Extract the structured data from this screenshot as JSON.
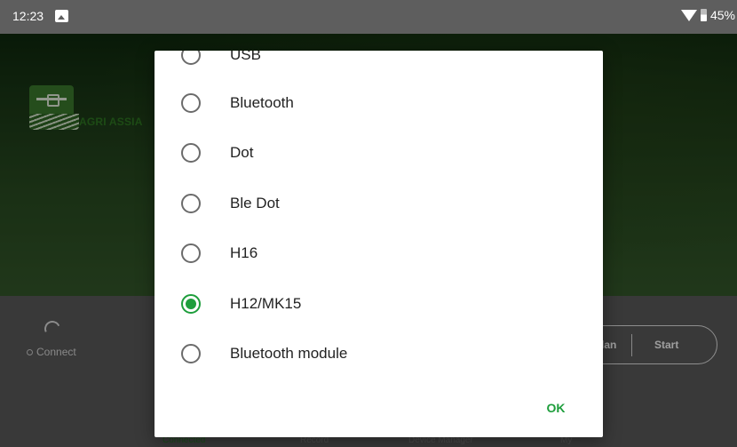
{
  "status_bar": {
    "time": "12:23",
    "battery": "45%",
    "icons": [
      "image-notification-icon",
      "wifi-icon",
      "battery-icon"
    ]
  },
  "app": {
    "logo_text": "AGRI ASSIA",
    "connect_label": "Connect",
    "plan_label": "lan",
    "start_label": "Start",
    "bottom_nav": [
      "Connected",
      "Record",
      "Device Manager",
      "My"
    ]
  },
  "dialog": {
    "options": [
      {
        "label": "USB",
        "checked": false
      },
      {
        "label": "Bluetooth",
        "checked": false
      },
      {
        "label": "Dot",
        "checked": false
      },
      {
        "label": "Ble Dot",
        "checked": false
      },
      {
        "label": "H16",
        "checked": false
      },
      {
        "label": "H12/MK15",
        "checked": true
      },
      {
        "label": "Bluetooth module",
        "checked": false
      }
    ],
    "ok_label": "OK"
  },
  "colors": {
    "accent": "#1e9e3c",
    "status_bar": "#5e5e5e",
    "panel": "#5c5c5c"
  }
}
